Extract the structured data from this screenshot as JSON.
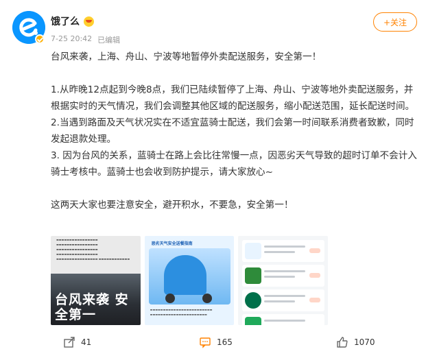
{
  "post": {
    "author": "饿了么",
    "timestamp": "7-25 20:42",
    "edited": "已编辑",
    "follow_label": "+关注",
    "brand_color": "#0a96ff",
    "accent_color": "#ff8200"
  },
  "content": {
    "intro": "台风来袭，上海、舟山、宁波等地暂停外卖配送服务，安全第一！",
    "point1": "1.从昨晚12点起到今晚8点，我们已陆续暂停了上海、舟山、宁波等地外卖配送服务，并根据实时的天气情况，我们会调整其他区域的配送服务，缩小配送范围，延长配送时间。",
    "point2": "2.当遇到路面及天气状况实在不适宜蓝骑士配送，我们会第一时间联系消费者致歉，同时发起退款处理。",
    "point3": "3. 因为台风的关系，蓝骑士在路上会比往常慢一点，因恶劣天气导致的超时订单不会计入骑士考核中。蓝骑士也会收到防护提示，请大家放心~",
    "closing": "这两天大家也要注意安全，避开积水，不要急，安全第一！"
  },
  "media": {
    "image1_text": "台风来袭 安全第一",
    "image2_title": "恶劣天气安全送餐指南"
  },
  "actions": {
    "share_count": "41",
    "comment_count": "165",
    "like_count": "1070"
  }
}
